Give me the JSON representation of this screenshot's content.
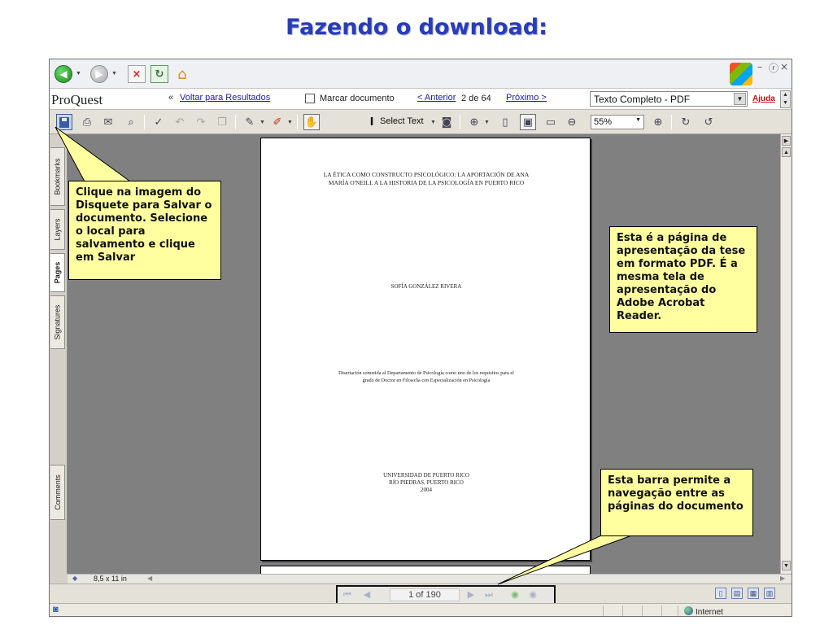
{
  "slide": {
    "title": "Fazendo o download:"
  },
  "browser": {
    "window_controls": [
      "–",
      "ⓡ",
      "×"
    ]
  },
  "proquest": {
    "logo": "ProQuest",
    "back_arrows": "«",
    "back_link": "Voltar para Resultados",
    "mark_document": "Marcar documento",
    "previous_link": "< Anterior",
    "position": "2 de 64",
    "next_link": "Próximo >",
    "format_selected": "Texto Completo - PDF",
    "help_link": "Ajuda"
  },
  "acrobat_toolbar": {
    "select_text_label": "Select Text",
    "zoom_value": "55%"
  },
  "side_tabs": [
    "Bookmarks",
    "Layers",
    "Pages",
    "Signatures",
    "Comments"
  ],
  "active_side_tab": "Pages",
  "document": {
    "title_line1": "LA ÉTICA COMO CONSTRUCTO PSICOLÓGICO: LA APORTACIÓN DE ANA",
    "title_line2": "MARÍA O'NEILL A LA HISTORIA DE LA PSICOLOGÍA EN PUERTO RICO",
    "author": "SOFÍA GONZÁLEZ RIVERA",
    "dissertation_line1": "Disertación sometida al Departamento de Psicología como uno de los requisitos para el",
    "dissertation_line2": "grado de Doctor en Filosofía con Especialización en Psicología",
    "university": "UNIVERSIDAD DE PUERTO RICO",
    "city": "RÍO PIEDRAS, PUERTO RICO",
    "year": "2004"
  },
  "page_size": "8,5 x 11 in",
  "navigation": {
    "page_indicator": "1 of 190"
  },
  "status_bar": {
    "zone": "Internet"
  },
  "callouts": {
    "save": "Clique na imagem do Disquete para Salvar o documento. Selecione o local para salvamento e clique em Salvar",
    "page": "Esta é a página de apresentação da tese em formato PDF. É a mesma tela de apresentação do Adobe Acrobat Reader.",
    "nav": "Esta barra  permite a navegação entre as páginas do documento"
  },
  "colors": {
    "title": "#2a3cb8",
    "callout_fill": "#ffffa0",
    "document_bg": "#808080"
  }
}
